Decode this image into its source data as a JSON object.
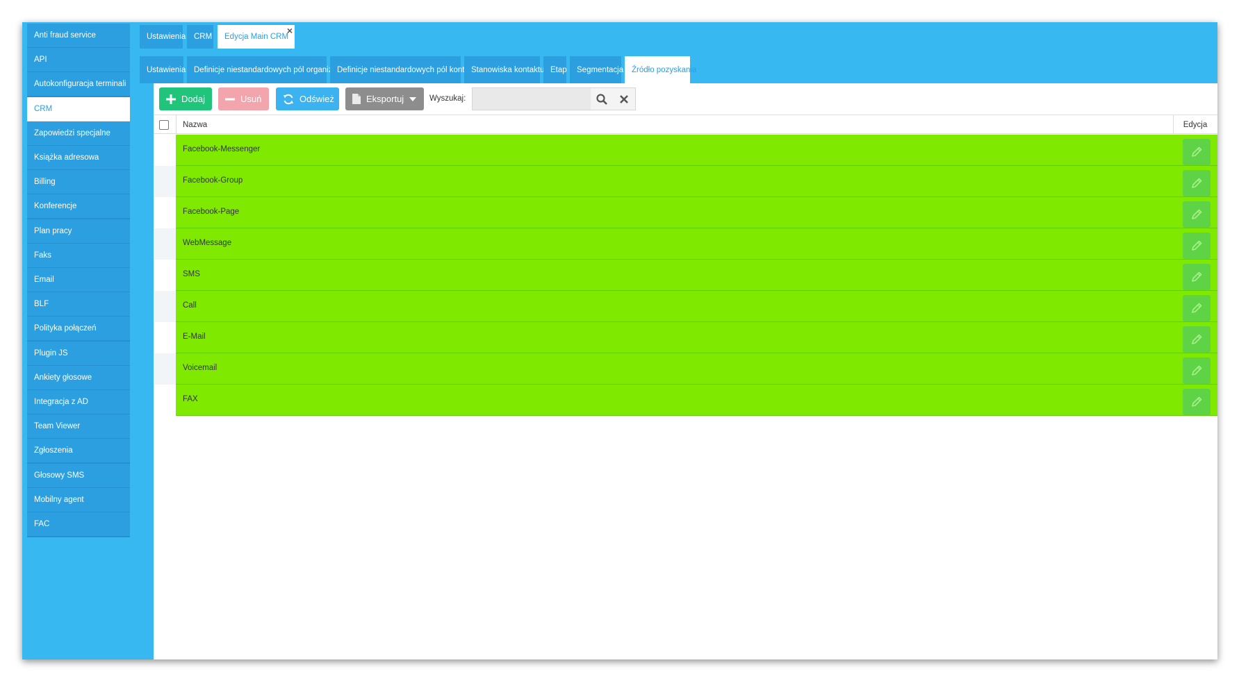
{
  "sidebar": {
    "items": [
      {
        "label": "Anti fraud service"
      },
      {
        "label": "API"
      },
      {
        "label": "Autokonfiguracja terminali"
      },
      {
        "label": "CRM",
        "active": true
      },
      {
        "label": "Zapowiedzi specjalne"
      },
      {
        "label": "Książka adresowa"
      },
      {
        "label": "Billing"
      },
      {
        "label": "Konferencje"
      },
      {
        "label": "Plan pracy"
      },
      {
        "label": "Faks"
      },
      {
        "label": "Email"
      },
      {
        "label": "BLF"
      },
      {
        "label": "Polityka połączeń"
      },
      {
        "label": "Plugin JS"
      },
      {
        "label": "Ankiety głosowe"
      },
      {
        "label": "Integracja z AD"
      },
      {
        "label": "Team Viewer"
      },
      {
        "label": "Zgłoszenia"
      },
      {
        "label": "Głosowy SMS"
      },
      {
        "label": "Mobilny agent"
      },
      {
        "label": "FAC"
      }
    ]
  },
  "top_tabs": [
    {
      "label": "Ustawienia"
    },
    {
      "label": "CRM"
    },
    {
      "label": "Edycja Main CRM",
      "active": true,
      "close_label": "×"
    }
  ],
  "sub_tabs": [
    {
      "label": "Ustawienia"
    },
    {
      "label": "Definicje niestandardowych pól organizacji"
    },
    {
      "label": "Definicje niestandardowych pól kontaktu"
    },
    {
      "label": "Stanowiska kontaktu"
    },
    {
      "label": "Etap"
    },
    {
      "label": "Segmentacja"
    },
    {
      "label": "Źródło pozyskania",
      "active": true
    }
  ],
  "toolbar": {
    "add_label": "Dodaj",
    "delete_label": "Usuń",
    "refresh_label": "Odśwież",
    "export_label": "Eksportuj",
    "search_label": "Wyszukaj:",
    "search_value": "",
    "search_placeholder": ""
  },
  "table": {
    "columns": {
      "name": "Nazwa",
      "edit": "Edycja"
    },
    "rows": [
      {
        "name": "Facebook-Messenger"
      },
      {
        "name": "Facebook-Group"
      },
      {
        "name": "Facebook-Page"
      },
      {
        "name": "WebMessage"
      },
      {
        "name": "SMS"
      },
      {
        "name": "Call"
      },
      {
        "name": "E-Mail"
      },
      {
        "name": "Voicemail"
      },
      {
        "name": "FAX"
      }
    ]
  },
  "colors": {
    "app_blue": "#37b8f0",
    "tab_blue": "#2b9fe0",
    "row_green": "#7fea00",
    "edit_green": "#5ed346",
    "add_green": "#20c47a",
    "delete_pink": "#f3a5ad",
    "refresh_blue": "#3ab3f0",
    "export_gray": "#8d8d8d"
  },
  "icons": {
    "add": "plus-icon",
    "delete": "minus-icon",
    "refresh": "refresh-icon",
    "export": "document-icon",
    "export_caret": "caret-down-icon",
    "search": "search-icon",
    "clear": "close-icon",
    "edit": "pencil-icon"
  }
}
